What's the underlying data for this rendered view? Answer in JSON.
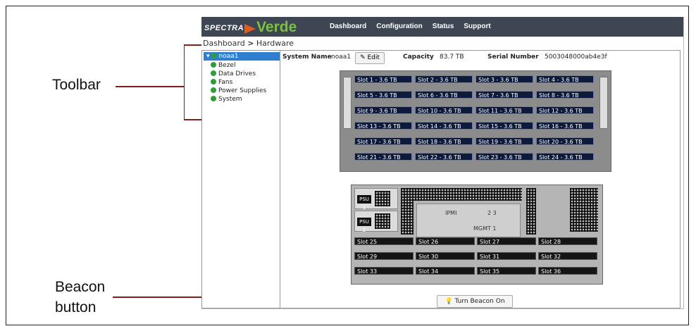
{
  "app": {
    "logo_brand": "SPECTRA",
    "logo_product": "Verde",
    "nav": [
      "Dashboard",
      "Configuration",
      "Status",
      "Support"
    ]
  },
  "breadcrumb": {
    "root": "Dashboard",
    "separator": ">",
    "current": "Hardware"
  },
  "tree": {
    "root": "noaa1",
    "items": [
      "Bezel",
      "Data Drives",
      "Fans",
      "Power Supplies",
      "System"
    ]
  },
  "system": {
    "name_label": "System Name",
    "name_value": "noaa1",
    "edit_label": "Edit",
    "capacity_label": "Capacity",
    "capacity_value": "83.7 TB",
    "serial_label": "Serial Number",
    "serial_value": "5003048000ab4e3f"
  },
  "front_slots": [
    "Slot 1 - 3.6 TB",
    "Slot 2 - 3.6 TB",
    "Slot 3 - 3.6 TB",
    "Slot 4 - 3.6 TB",
    "Slot 5 - 3.6 TB",
    "Slot 6 - 3.6 TB",
    "Slot 7 - 3.6 TB",
    "Slot 8 - 3.6 TB",
    "Slot 9 - 3.6 TB",
    "Slot 10 - 3.6 TB",
    "Slot 11 - 3.6 TB",
    "Slot 12 - 3.6 TB",
    "Slot 13 - 3.6 TB",
    "Slot 14 - 3.6 TB",
    "Slot 15 - 3.6 TB",
    "Slot 16 - 3.6 TB",
    "Slot 17 - 3.6 TB",
    "Slot 18 - 3.6 TB",
    "Slot 19 - 3.6 TB",
    "Slot 20 - 3.6 TB",
    "Slot 21 - 3.6 TB",
    "Slot 22 - 3.6 TB",
    "Slot 23 - 3.6 TB",
    "Slot 24 - 3.6 TB"
  ],
  "rear": {
    "psu": [
      "PSU 1",
      "PSU 2"
    ],
    "ipmi_label": "IPMI",
    "port_numbers": "2 3",
    "mgmt_label": "MGMT 1",
    "slots": [
      "Slot 25",
      "Slot 26",
      "Slot 27",
      "Slot 28",
      "Slot 29",
      "Slot 30",
      "Slot 31",
      "Slot 32",
      "Slot 33",
      "Slot 34",
      "Slot 35",
      "Slot 36"
    ]
  },
  "beacon_button": "Turn Beacon On",
  "callouts": {
    "toolbar": "Toolbar",
    "beacon_line1": "Beacon",
    "beacon_line2": "button"
  },
  "colors": {
    "callout": "#8b1a1a",
    "topbar": "#3d4652",
    "tree_selected": "#2f7fd1",
    "status_ok": "#2f9e3a",
    "verde": "#7cc142"
  }
}
